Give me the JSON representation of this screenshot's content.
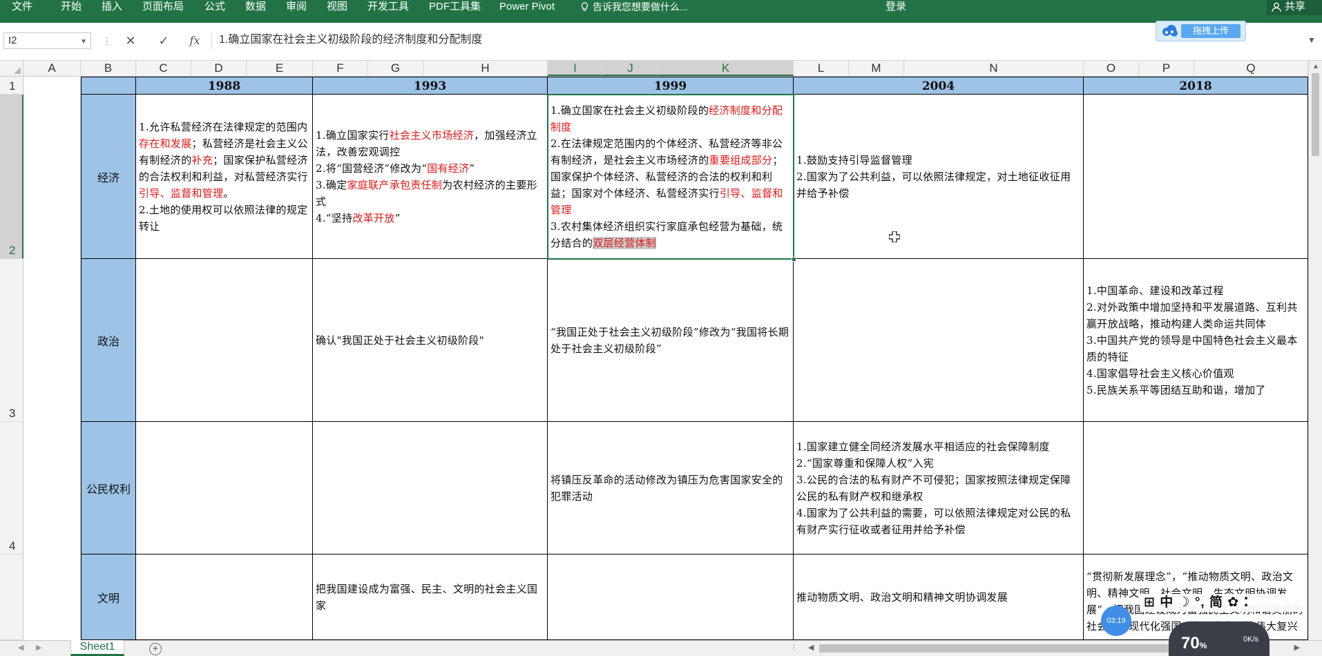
{
  "ribbon": {
    "tabs": [
      "文件",
      "开始",
      "插入",
      "页面布局",
      "公式",
      "数据",
      "审阅",
      "视图",
      "开发工具",
      "PDF工具集",
      "Power Pivot"
    ],
    "tell_me": "告诉我您想要做什么...",
    "login": "登录",
    "share": "共享"
  },
  "formula_bar": {
    "name_box": "I2",
    "cancel_icon": "✕",
    "enter_icon": "✓",
    "fx_label": "fx",
    "formula": "1.确立国家在社会主义初级阶段的经济制度和分配制度",
    "upload_label": "拖拽上传"
  },
  "columns": [
    "A",
    "B",
    "C",
    "D",
    "E",
    "F",
    "G",
    "H",
    "I",
    "J",
    "K",
    "L",
    "M",
    "N",
    "O",
    "P",
    "Q"
  ],
  "selected_columns": [
    "I",
    "J",
    "K"
  ],
  "rows": [
    "1",
    "2",
    "3",
    "4"
  ],
  "header_row": {
    "years": [
      "1988",
      "1993",
      "1999",
      "2004",
      "2018"
    ]
  },
  "row_labels": {
    "economy": "经济",
    "politics": "政治",
    "civil_rights": "公民权利",
    "civilization": "文明"
  },
  "cells": {
    "econ_1988": {
      "l1a": "1.允许私营经济在法律规定的范围内",
      "l1b": "存在和发展",
      "l1c": "；私营经济是社会主义公有制经济的",
      "l1d": "补充",
      "l1e": "；国家保护私营经济的合法权利和利益，对私营经济实行",
      "l1f": "引导、监督和管理",
      "l1g": "。",
      "l2": "2.土地的使用权可以依照法律的规定转让"
    },
    "econ_1993": {
      "l1a": "1.确立国家实行",
      "l1b": "社会主义市场经济",
      "l1c": "，加强经济立法，改善宏观调控",
      "l2a": "2.将“国营经济”修改为“",
      "l2b": "国有经济",
      "l2c": "”",
      "l3a": "3.确定",
      "l3b": "家庭联产承包责任制",
      "l3c": "为农村经济的主要形式",
      "l4a": "4.“坚持",
      "l4b": "改革开放",
      "l4c": "”"
    },
    "econ_1999": {
      "l1a": "1.确立国家在社会主义初级阶段的",
      "l1b": "经济制度和分配制度",
      "l2a": "2.在法律规定范围内的个体经济、私营经济等非公有制经济，是社会主义市场经济的",
      "l2b": "重要组成部分",
      "l2c": "；国家保护个体经济、私营经济的合法的权利和利益；国家对个体经济、私营经济实行",
      "l2d": "引导、监督和管理",
      "l3a": "3.农村集体经济组织实行家庭承包经营为基础，统分结合的",
      "l3b": "双层经营体制"
    },
    "econ_2004": {
      "l1": "1.鼓励支持引导监督管理",
      "l2": "2.国家为了公共利益，可以依照法律规定，对土地征收征用并给予补偿"
    },
    "pol_1993": "确认\"我国正处于社会主义初级阶段\"",
    "pol_1999": "“我国正处于社会主义初级阶段”修改为“我国将长期处于社会主义初级阶段”",
    "pol_2018": {
      "l1": "1.中国革命、建设和改革过程",
      "l2": "2.对外政策中增加坚持和平发展道路、互利共赢开放战略，推动构建人类命运共同体",
      "l3": "3.中国共产党的领导是中国特色社会主义最本质的特征",
      "l4": "4.国家倡导社会主义核心价值观",
      "l5": "5.民族关系平等团结互助和谐，增加了"
    },
    "rights_1999": "将镇压反革命的活动修改为镇压为危害国家安全的犯罪活动",
    "rights_2004": {
      "l1": "1.国家建立健全同经济发展水平相适应的社会保障制度",
      "l2": "2.“国家尊重和保障人权”入宪",
      "l3": "3.公民的合法的私有财产不可侵犯；国家按照法律规定保障公民的私有财产权和继承权",
      "l4": "4.国家为了公共利益的需要，可以依照法律规定对公民的私有财产实行征收或者征用并给予补偿"
    },
    "civ_1993": "把我国建设成为富强、民主、文明的社会主义国家",
    "civ_2004": "推动物质文明、政治文明和精神文明协调发展",
    "civ_2018": "“贯彻新发展理念”，“推动物质文明、政治文明、精神文明、社会文明、生态文明协调发展”，把我国建设成为富强民主文明和谐美丽的社会主义现代化强国，实现中华民族伟大复兴"
  },
  "sheet_tabs": [
    "Sheet1"
  ],
  "ime": {
    "label": "中",
    "mode": "简"
  },
  "timer": "03:19",
  "net_widget": {
    "percent": "70",
    "percent_unit": "%",
    "speed": "0K/s"
  },
  "colors": {
    "ribbon": "#217346",
    "header_fill": "#9dc3e6",
    "highlight_text": "#e21818"
  }
}
